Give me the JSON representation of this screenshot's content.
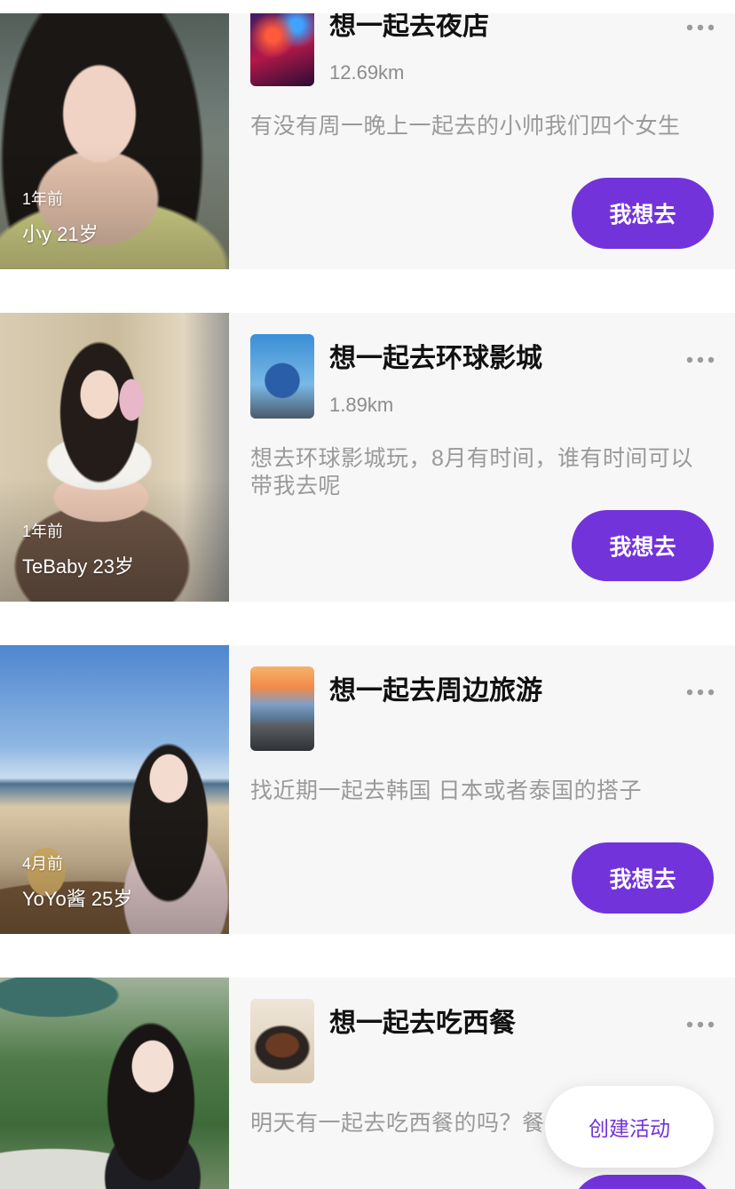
{
  "colors": {
    "accent": "#7233DB",
    "panel": "#F7F7F7",
    "secondary_text": "#8C8C8C",
    "description_text": "#9A9A9A"
  },
  "icons": {
    "more_options": "more-options-icon"
  },
  "cards": [
    {
      "post_time": "1年前",
      "user": "小y 21岁",
      "title": "想一起去夜店",
      "distance": "12.69km",
      "description": "有没有周一晚上一起去的小帅我们四个女生",
      "button_label": "我想去",
      "thumbnail": "nightclub-thumbnail"
    },
    {
      "post_time": "1年前",
      "user": "TeBaby 23岁",
      "title": "想一起去环球影城",
      "distance": "1.89km",
      "description": "想去环球影城玩，8月有时间，谁有时间可以带我去呢",
      "button_label": "我想去",
      "thumbnail": "universal-studios-thumbnail"
    },
    {
      "post_time": "4月前",
      "user": "YoYo酱 25岁",
      "title": "想一起去周边旅游",
      "description": "找近期一起去韩国 日本或者泰国的搭子",
      "button_label": "我想去",
      "thumbnail": "scenic-road-thumbnail"
    },
    {
      "title": "想一起去吃西餐",
      "description": "明天有一起去吃西餐的吗？餐",
      "thumbnail": "steak-thumbnail"
    }
  ],
  "fab": {
    "label": "创建活动"
  }
}
